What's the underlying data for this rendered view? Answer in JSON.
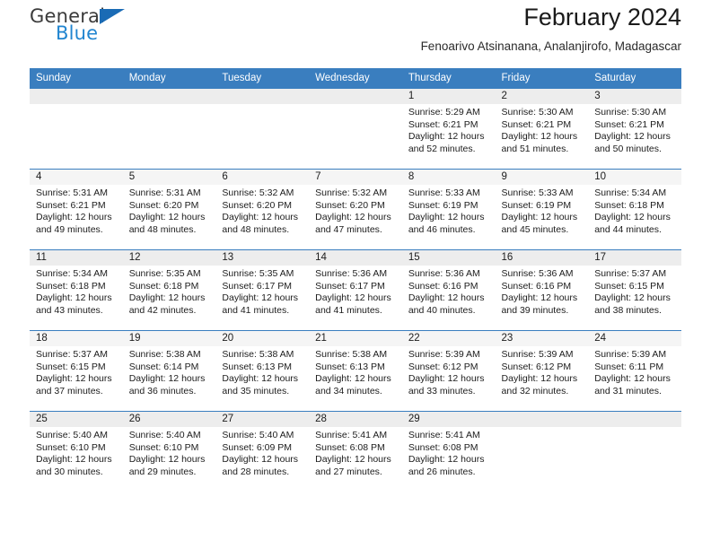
{
  "brand": {
    "name_primary": "General",
    "name_secondary": "Blue",
    "primary_color": "#3b3b3b",
    "secondary_color": "#2185d0",
    "triangle_color": "#1a6bb5"
  },
  "header": {
    "title": "February 2024",
    "subtitle": "Fenoarivo Atsinanana, Analanjirofo, Madagascar"
  },
  "calendar": {
    "header_bg": "#3a7ebf",
    "header_text_color": "#ffffff",
    "weekday_headers": [
      "Sunday",
      "Monday",
      "Tuesday",
      "Wednesday",
      "Thursday",
      "Friday",
      "Saturday"
    ],
    "weeks": [
      [
        {
          "day": ""
        },
        {
          "day": ""
        },
        {
          "day": ""
        },
        {
          "day": ""
        },
        {
          "day": "1",
          "sunrise": "Sunrise: 5:29 AM",
          "sunset": "Sunset: 6:21 PM",
          "daylight_line1": "Daylight: 12 hours",
          "daylight_line2": "and 52 minutes."
        },
        {
          "day": "2",
          "sunrise": "Sunrise: 5:30 AM",
          "sunset": "Sunset: 6:21 PM",
          "daylight_line1": "Daylight: 12 hours",
          "daylight_line2": "and 51 minutes."
        },
        {
          "day": "3",
          "sunrise": "Sunrise: 5:30 AM",
          "sunset": "Sunset: 6:21 PM",
          "daylight_line1": "Daylight: 12 hours",
          "daylight_line2": "and 50 minutes."
        }
      ],
      [
        {
          "day": "4",
          "sunrise": "Sunrise: 5:31 AM",
          "sunset": "Sunset: 6:21 PM",
          "daylight_line1": "Daylight: 12 hours",
          "daylight_line2": "and 49 minutes."
        },
        {
          "day": "5",
          "sunrise": "Sunrise: 5:31 AM",
          "sunset": "Sunset: 6:20 PM",
          "daylight_line1": "Daylight: 12 hours",
          "daylight_line2": "and 48 minutes."
        },
        {
          "day": "6",
          "sunrise": "Sunrise: 5:32 AM",
          "sunset": "Sunset: 6:20 PM",
          "daylight_line1": "Daylight: 12 hours",
          "daylight_line2": "and 48 minutes."
        },
        {
          "day": "7",
          "sunrise": "Sunrise: 5:32 AM",
          "sunset": "Sunset: 6:20 PM",
          "daylight_line1": "Daylight: 12 hours",
          "daylight_line2": "and 47 minutes."
        },
        {
          "day": "8",
          "sunrise": "Sunrise: 5:33 AM",
          "sunset": "Sunset: 6:19 PM",
          "daylight_line1": "Daylight: 12 hours",
          "daylight_line2": "and 46 minutes."
        },
        {
          "day": "9",
          "sunrise": "Sunrise: 5:33 AM",
          "sunset": "Sunset: 6:19 PM",
          "daylight_line1": "Daylight: 12 hours",
          "daylight_line2": "and 45 minutes."
        },
        {
          "day": "10",
          "sunrise": "Sunrise: 5:34 AM",
          "sunset": "Sunset: 6:18 PM",
          "daylight_line1": "Daylight: 12 hours",
          "daylight_line2": "and 44 minutes."
        }
      ],
      [
        {
          "day": "11",
          "sunrise": "Sunrise: 5:34 AM",
          "sunset": "Sunset: 6:18 PM",
          "daylight_line1": "Daylight: 12 hours",
          "daylight_line2": "and 43 minutes."
        },
        {
          "day": "12",
          "sunrise": "Sunrise: 5:35 AM",
          "sunset": "Sunset: 6:18 PM",
          "daylight_line1": "Daylight: 12 hours",
          "daylight_line2": "and 42 minutes."
        },
        {
          "day": "13",
          "sunrise": "Sunrise: 5:35 AM",
          "sunset": "Sunset: 6:17 PM",
          "daylight_line1": "Daylight: 12 hours",
          "daylight_line2": "and 41 minutes."
        },
        {
          "day": "14",
          "sunrise": "Sunrise: 5:36 AM",
          "sunset": "Sunset: 6:17 PM",
          "daylight_line1": "Daylight: 12 hours",
          "daylight_line2": "and 41 minutes."
        },
        {
          "day": "15",
          "sunrise": "Sunrise: 5:36 AM",
          "sunset": "Sunset: 6:16 PM",
          "daylight_line1": "Daylight: 12 hours",
          "daylight_line2": "and 40 minutes."
        },
        {
          "day": "16",
          "sunrise": "Sunrise: 5:36 AM",
          "sunset": "Sunset: 6:16 PM",
          "daylight_line1": "Daylight: 12 hours",
          "daylight_line2": "and 39 minutes."
        },
        {
          "day": "17",
          "sunrise": "Sunrise: 5:37 AM",
          "sunset": "Sunset: 6:15 PM",
          "daylight_line1": "Daylight: 12 hours",
          "daylight_line2": "and 38 minutes."
        }
      ],
      [
        {
          "day": "18",
          "sunrise": "Sunrise: 5:37 AM",
          "sunset": "Sunset: 6:15 PM",
          "daylight_line1": "Daylight: 12 hours",
          "daylight_line2": "and 37 minutes."
        },
        {
          "day": "19",
          "sunrise": "Sunrise: 5:38 AM",
          "sunset": "Sunset: 6:14 PM",
          "daylight_line1": "Daylight: 12 hours",
          "daylight_line2": "and 36 minutes."
        },
        {
          "day": "20",
          "sunrise": "Sunrise: 5:38 AM",
          "sunset": "Sunset: 6:13 PM",
          "daylight_line1": "Daylight: 12 hours",
          "daylight_line2": "and 35 minutes."
        },
        {
          "day": "21",
          "sunrise": "Sunrise: 5:38 AM",
          "sunset": "Sunset: 6:13 PM",
          "daylight_line1": "Daylight: 12 hours",
          "daylight_line2": "and 34 minutes."
        },
        {
          "day": "22",
          "sunrise": "Sunrise: 5:39 AM",
          "sunset": "Sunset: 6:12 PM",
          "daylight_line1": "Daylight: 12 hours",
          "daylight_line2": "and 33 minutes."
        },
        {
          "day": "23",
          "sunrise": "Sunrise: 5:39 AM",
          "sunset": "Sunset: 6:12 PM",
          "daylight_line1": "Daylight: 12 hours",
          "daylight_line2": "and 32 minutes."
        },
        {
          "day": "24",
          "sunrise": "Sunrise: 5:39 AM",
          "sunset": "Sunset: 6:11 PM",
          "daylight_line1": "Daylight: 12 hours",
          "daylight_line2": "and 31 minutes."
        }
      ],
      [
        {
          "day": "25",
          "sunrise": "Sunrise: 5:40 AM",
          "sunset": "Sunset: 6:10 PM",
          "daylight_line1": "Daylight: 12 hours",
          "daylight_line2": "and 30 minutes."
        },
        {
          "day": "26",
          "sunrise": "Sunrise: 5:40 AM",
          "sunset": "Sunset: 6:10 PM",
          "daylight_line1": "Daylight: 12 hours",
          "daylight_line2": "and 29 minutes."
        },
        {
          "day": "27",
          "sunrise": "Sunrise: 5:40 AM",
          "sunset": "Sunset: 6:09 PM",
          "daylight_line1": "Daylight: 12 hours",
          "daylight_line2": "and 28 minutes."
        },
        {
          "day": "28",
          "sunrise": "Sunrise: 5:41 AM",
          "sunset": "Sunset: 6:08 PM",
          "daylight_line1": "Daylight: 12 hours",
          "daylight_line2": "and 27 minutes."
        },
        {
          "day": "29",
          "sunrise": "Sunrise: 5:41 AM",
          "sunset": "Sunset: 6:08 PM",
          "daylight_line1": "Daylight: 12 hours",
          "daylight_line2": "and 26 minutes."
        },
        {
          "day": ""
        },
        {
          "day": ""
        }
      ]
    ]
  }
}
